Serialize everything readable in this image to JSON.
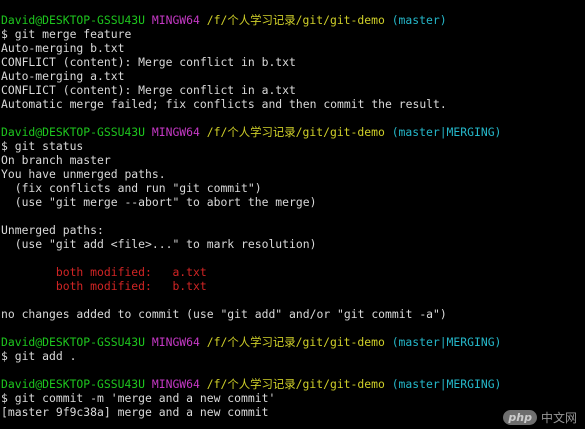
{
  "colors": {
    "user": "#1ec71e",
    "shell": "#c639c6",
    "path": "#cfcf29",
    "branch": "#25b7c9",
    "conflict": "#d02424",
    "text": "#d9d9d9",
    "background": "#000000"
  },
  "prompt": {
    "user_host": "David@DESKTOP-GSSU43U",
    "shell": "MINGW64",
    "path": "/f/个人学习记录/git/git-demo"
  },
  "blocks": [
    {
      "branch": "(master)",
      "command": "$ git merge feature",
      "output": [
        "Auto-merging b.txt",
        "CONFLICT (content): Merge conflict in b.txt",
        "Auto-merging a.txt",
        "CONFLICT (content): Merge conflict in a.txt",
        "Automatic merge failed; fix conflicts and then commit the result."
      ]
    },
    {
      "branch": "(master|MERGING)",
      "command": "$ git status",
      "output_a": [
        "On branch master",
        "You have unmerged paths.",
        "  (fix conflicts and run \"git commit\")",
        "  (use \"git merge --abort\" to abort the merge)"
      ],
      "output_b": [
        "Unmerged paths:",
        "  (use \"git add <file>...\" to mark resolution)"
      ],
      "conflicts": [
        "        both modified:   a.txt",
        "        both modified:   b.txt"
      ],
      "output_c": [
        "no changes added to commit (use \"git add\" and/or \"git commit -a\")"
      ]
    },
    {
      "branch": "(master|MERGING)",
      "command": "$ git add ."
    },
    {
      "branch": "(master|MERGING)",
      "command": "$ git commit -m 'merge and a new commit'",
      "output": [
        "[master 9f9c38a] merge and a new commit"
      ]
    }
  ],
  "watermark": {
    "logo": "php",
    "text": "中文网"
  }
}
